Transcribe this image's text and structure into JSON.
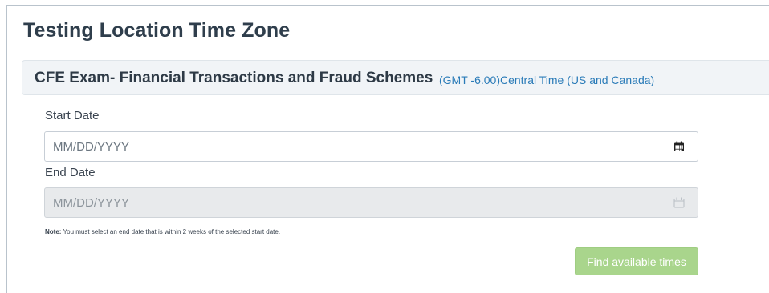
{
  "page": {
    "title": "Testing Location Time Zone"
  },
  "exam": {
    "name": "CFE Exam- Financial Transactions and Fraud Schemes",
    "timezone": "(GMT -6.00)Central Time (US and Canada)"
  },
  "form": {
    "start_date": {
      "label": "Start Date",
      "placeholder": "MM/DD/YYYY",
      "value": "",
      "icon": "calendar-icon",
      "disabled": false
    },
    "end_date": {
      "label": "End Date",
      "placeholder": "MM/DD/YYYY",
      "value": "",
      "icon": "calendar-icon",
      "disabled": true
    },
    "note_label": "Note:",
    "note_text": " You must select an end date that is within 2 weeks of the selected start date.",
    "find_button": "Find available times"
  },
  "colors": {
    "title_text": "#2f3e4c",
    "timezone_link": "#2a7bb8",
    "button_bg": "#a9d58c",
    "disabled_input_bg": "#e8eaec"
  }
}
